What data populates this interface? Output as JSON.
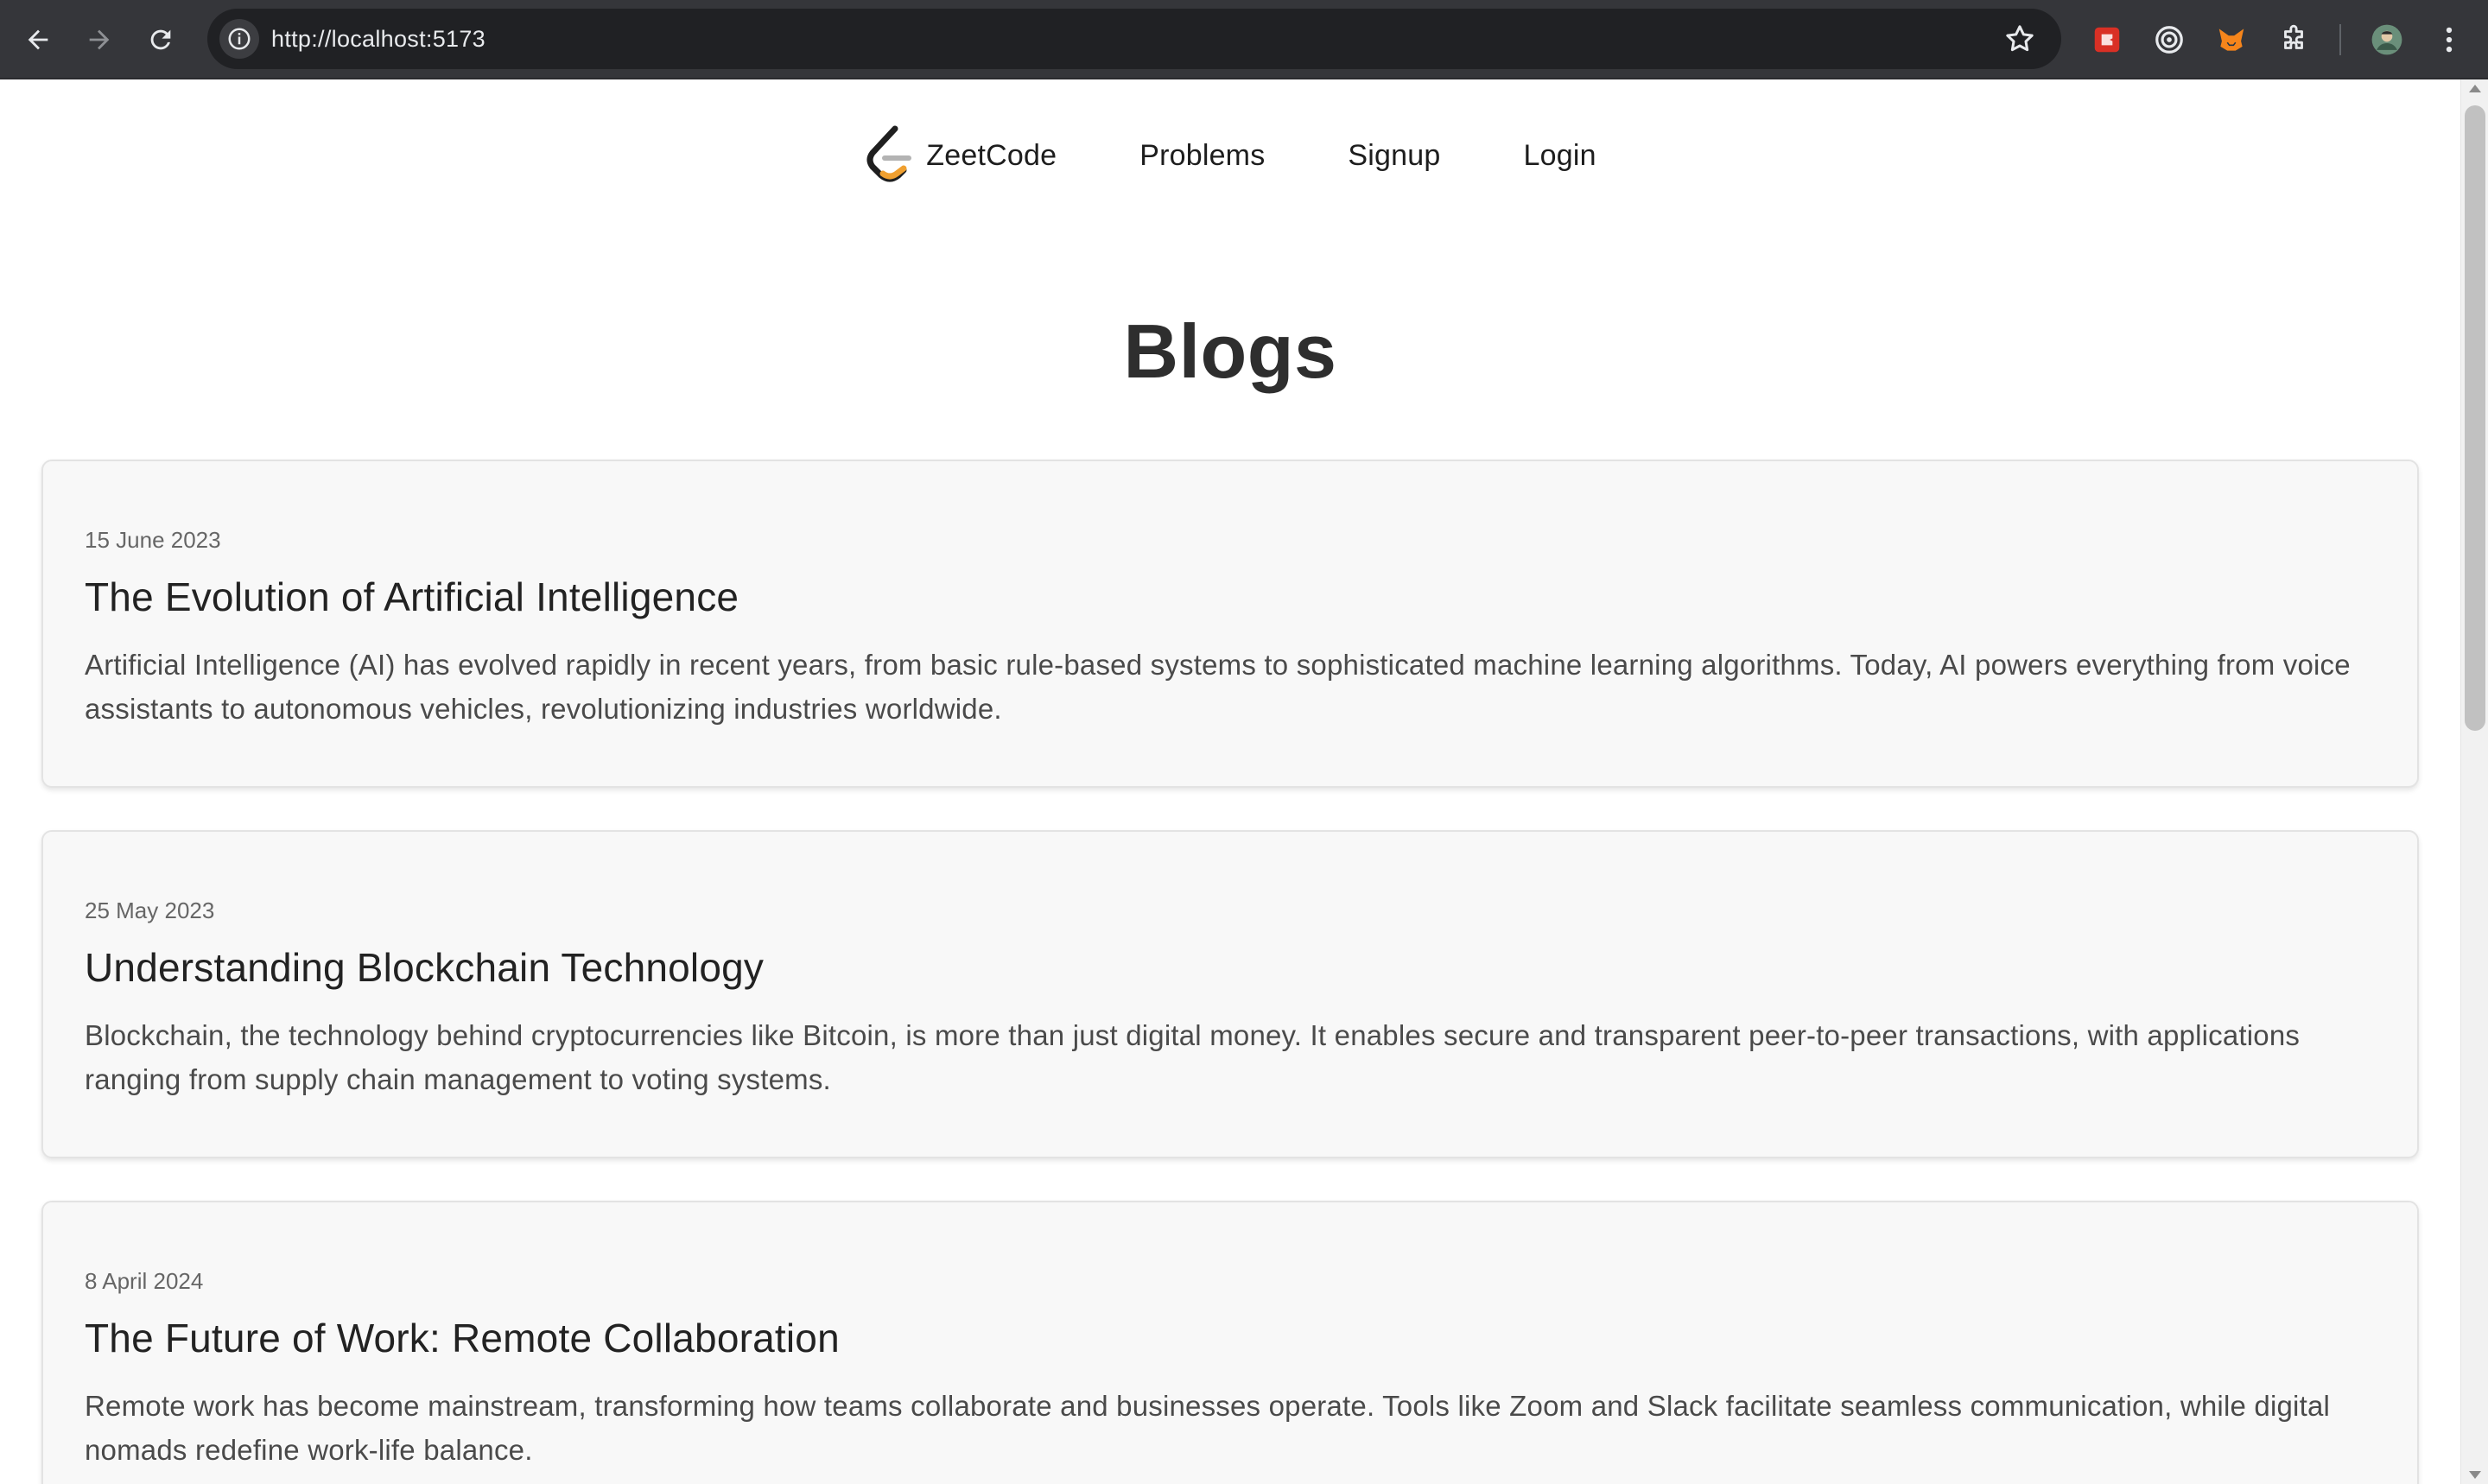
{
  "browser": {
    "url": "http://localhost:5173",
    "icons": [
      "back-icon",
      "forward-icon",
      "reload-icon",
      "site-info-icon",
      "bookmark-star-icon",
      "extension-icon",
      "profile-avatar-icon",
      "menu-icon"
    ]
  },
  "nav": {
    "brand": "ZeetCode",
    "links": [
      "Problems",
      "Signup",
      "Login"
    ]
  },
  "page": {
    "title": "Blogs"
  },
  "posts": [
    {
      "date": "15 June 2023",
      "title": "The Evolution of Artificial Intelligence",
      "body": "Artificial Intelligence (AI) has evolved rapidly in recent years, from basic rule-based systems to sophisticated machine learning algorithms. Today, AI powers everything from voice assistants to autonomous vehicles, revolutionizing industries worldwide."
    },
    {
      "date": "25 May 2023",
      "title": "Understanding Blockchain Technology",
      "body": "Blockchain, the technology behind cryptocurrencies like Bitcoin, is more than just digital money. It enables secure and transparent peer-to-peer transactions, with applications ranging from supply chain management to voting systems."
    },
    {
      "date": "8 April 2024",
      "title": "The Future of Work: Remote Collaboration",
      "body": "Remote work has become mainstream, transforming how teams collaborate and businesses operate. Tools like Zoom and Slack facilitate seamless communication, while digital nomads redefine work-life balance."
    }
  ],
  "colors": {
    "chrome": "#35363a",
    "omnibox": "#202124",
    "card_bg": "#f8f8f8",
    "brand_orange": "#f0a030",
    "brand_dark": "#1f1f1f"
  }
}
